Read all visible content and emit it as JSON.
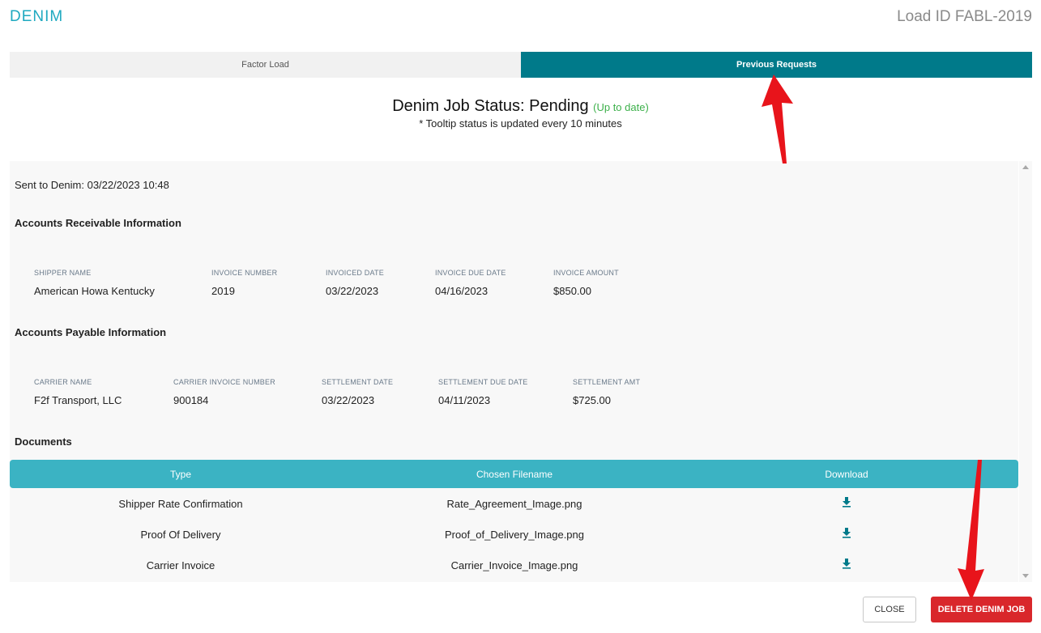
{
  "header": {
    "brand": "DENIM",
    "load_id": "Load ID FABL-2019"
  },
  "tabs": [
    {
      "label": "Factor Load",
      "active": false
    },
    {
      "label": "Previous Requests",
      "active": true
    }
  ],
  "status": {
    "title": "Denim Job Status: Pending",
    "freshness": "(Up to date)",
    "note": "* Tooltip status is updated every 10 minutes"
  },
  "details": {
    "sent": "Sent to Denim: 03/22/2023 10:48",
    "ar_title": "Accounts Receivable Information",
    "ar": {
      "shipper_name_label": "SHIPPER NAME",
      "shipper_name": "American Howa Kentucky",
      "invoice_number_label": "INVOICE NUMBER",
      "invoice_number": "2019",
      "invoiced_date_label": "INVOICED DATE",
      "invoiced_date": "03/22/2023",
      "invoice_due_date_label": "INVOICE DUE DATE",
      "invoice_due_date": "04/16/2023",
      "invoice_amount_label": "INVOICE AMOUNT",
      "invoice_amount": "$850.00"
    },
    "ap_title": "Accounts Payable Information",
    "ap": {
      "carrier_name_label": "CARRIER NAME",
      "carrier_name": "F2f Transport, LLC",
      "carrier_invoice_number_label": "CARRIER INVOICE NUMBER",
      "carrier_invoice_number": "900184",
      "settlement_date_label": "SETTLEMENT DATE",
      "settlement_date": "03/22/2023",
      "settlement_due_date_label": "SETTLEMENT DUE DATE",
      "settlement_due_date": "04/11/2023",
      "settlement_amt_label": "SETTLEMENT AMT",
      "settlement_amt": "$725.00"
    },
    "documents_title": "Documents",
    "documents": {
      "columns": [
        "Type",
        "Chosen Filename",
        "Download"
      ],
      "rows": [
        {
          "type": "Shipper Rate Confirmation",
          "filename": "Rate_Agreement_Image.png"
        },
        {
          "type": "Proof Of Delivery",
          "filename": "Proof_of_Delivery_Image.png"
        },
        {
          "type": "Carrier Invoice",
          "filename": "Carrier_Invoice_Image.png"
        }
      ]
    }
  },
  "footer": {
    "close_label": "CLOSE",
    "delete_label": "DELETE DENIM JOB"
  },
  "icons": {
    "download": "download-icon",
    "annotation": "red-arrow"
  },
  "colors": {
    "brand": "#1fa9c0",
    "active_tab": "#007a8a",
    "table_header": "#3bb3c3",
    "download_icon": "#007a8a",
    "up_to_date": "#3cb04a",
    "delete_button": "#d9272b",
    "annotation_arrow": "#e8141b"
  }
}
